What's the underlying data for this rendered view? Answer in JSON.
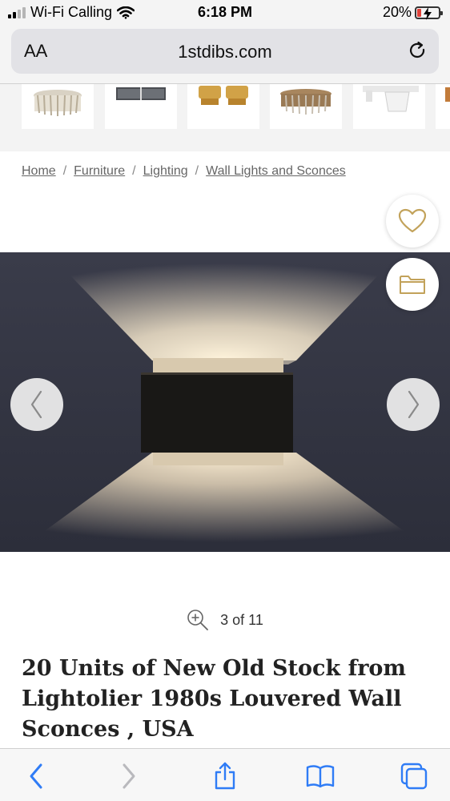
{
  "status_bar": {
    "carrier": "Wi-Fi Calling",
    "time": "6:18 PM",
    "battery_percent": "20%",
    "battery_level": 0.2,
    "battery_color": "#e0423a",
    "icons": [
      "signal-icon",
      "wifi-icon",
      "battery-icon",
      "charging-bolt-icon"
    ]
  },
  "address_bar": {
    "text_size_label": "AA",
    "url": "1stdibs.com",
    "reload_icon": "reload-icon"
  },
  "breadcrumb": {
    "items": [
      "Home",
      "Furniture",
      "Lighting",
      "Wall Lights and Sconces"
    ],
    "separator": "/"
  },
  "gallery": {
    "counter": "3 of 11",
    "zoom_icon": "zoom-in-icon",
    "favorite_icon": "heart-icon",
    "folder_icon": "folder-icon",
    "prev_icon": "chevron-left-icon",
    "next_icon": "chevron-right-icon",
    "accent_color": "#c2a25a"
  },
  "product": {
    "title": "20 Units of New Old Stock from Lightolier 1980s Louvered Wall Sconces , USA"
  },
  "toolbar": {
    "icons": [
      "back-icon",
      "forward-icon",
      "share-icon",
      "bookmarks-icon",
      "tabs-icon"
    ],
    "accent_color": "#2f7cf6"
  }
}
